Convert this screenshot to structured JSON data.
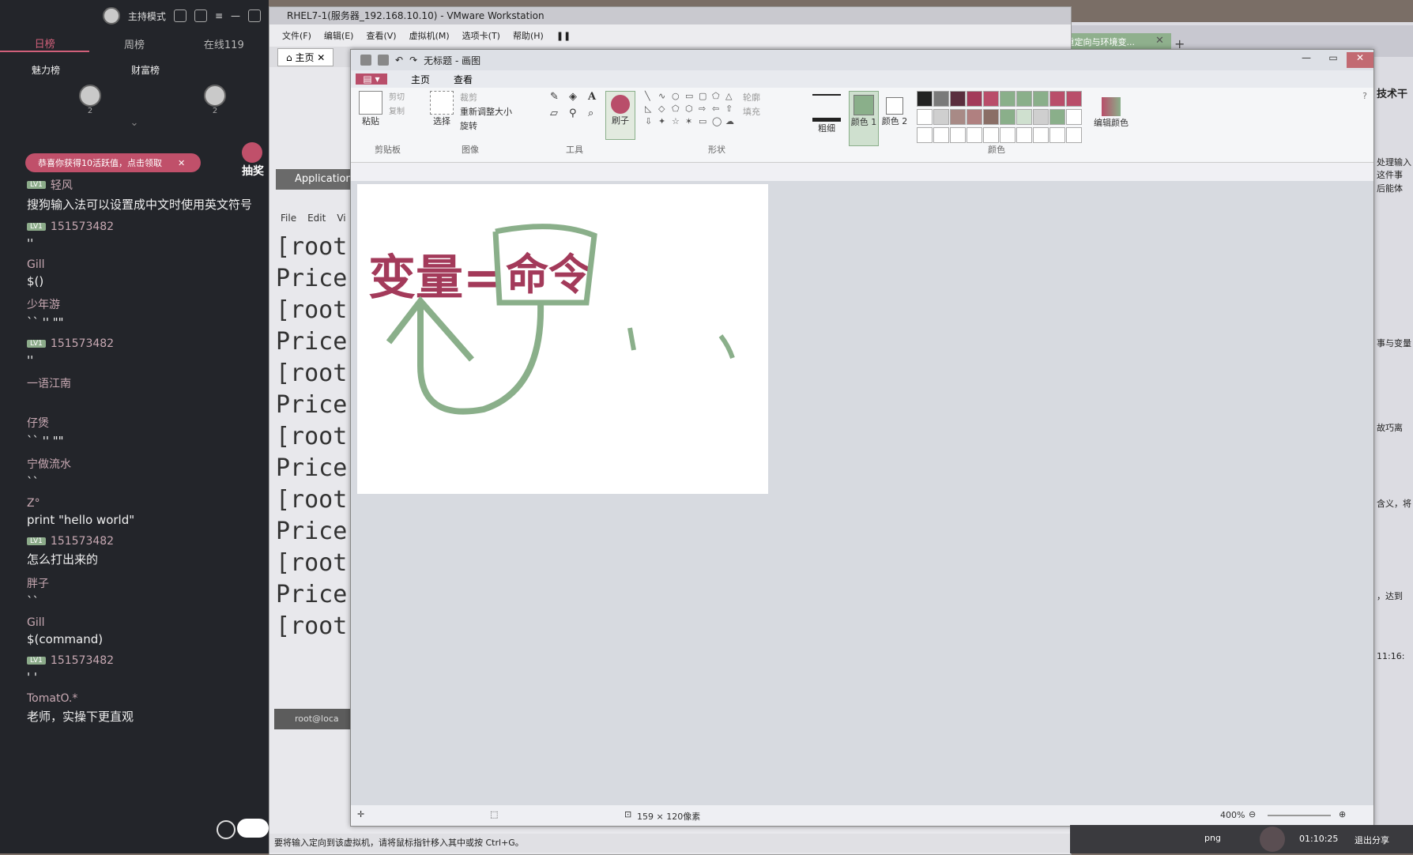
{
  "live_panel": {
    "host_mode": "主持模式",
    "tabs": [
      "日榜",
      "周榜",
      "在线119"
    ],
    "ranks": [
      "魅力榜",
      "财富榜"
    ],
    "rank_counts": [
      "2",
      "2"
    ],
    "notice": "恭喜你获得10活跃值，点击领取",
    "lottery": "抽奖",
    "messages": [
      {
        "user": "轻风",
        "lv": "LV1",
        "text": "搜狗输入法可以设置成中文时使用英文符号"
      },
      {
        "user": "151573482",
        "lv": "LV1",
        "text": "''"
      },
      {
        "user": "Gill",
        "lv": "",
        "text": "$()"
      },
      {
        "user": "少年游",
        "lv": "",
        "text": "`` '' \"\""
      },
      {
        "user": "151573482",
        "lv": "LV1",
        "text": "''"
      },
      {
        "user": "一语江南",
        "lv": "",
        "text": ""
      },
      {
        "user": "仔煲",
        "lv": "",
        "text": "`` '' \"\""
      },
      {
        "user": "宁做流水",
        "lv": "",
        "text": "``"
      },
      {
        "user": "Z°",
        "lv": "",
        "text": "print \"hello world\""
      },
      {
        "user": "151573482",
        "lv": "LV1",
        "text": "怎么打出来的"
      },
      {
        "user": "胖子",
        "lv": "",
        "text": "``"
      },
      {
        "user": "Gill",
        "lv": "",
        "text": "$(command)"
      },
      {
        "user": "151573482",
        "lv": "LV1",
        "text": "'  '"
      },
      {
        "user": "TomatO.*",
        "lv": "",
        "text": "老师，实操下更直观"
      }
    ]
  },
  "vmware": {
    "title": "RHEL7-1(服务器_192.168.10.10) - VMware Workstation",
    "menu": [
      "文件(F)",
      "编辑(E)",
      "查看(V)",
      "虚拟机(M)",
      "选项卡(T)",
      "帮助(H)"
    ],
    "tab": "主页",
    "app_label": "Application",
    "file_menu": [
      "File",
      "Edit",
      "Vi"
    ],
    "terminal_lines": [
      "[root",
      "Price",
      "[root",
      "Price",
      "[root",
      "Price",
      "[root",
      "Price",
      "[root",
      "Price",
      "[root",
      "Price",
      "[root"
    ],
    "task_label": "root@loca",
    "status": "要将输入定向到该虚拟机，请将鼠标指针移入其中或按 Ctrl+G。"
  },
  "right_app": {
    "tab_title": "第3章 管道符、重定向与环境变...",
    "side_texts": [
      "技术干",
      "处理输入",
      "这件事",
      "后能体",
      "事与变量",
      "故巧离",
      "含义，将",
      "，达到",
      "11:16:"
    ]
  },
  "paint": {
    "title": "无标题 - 画图",
    "ribbon_tabs": [
      "主页",
      "查看"
    ],
    "clipboard": {
      "paste": "粘贴",
      "cut": "剪切",
      "copy": "复制",
      "label": "剪贴板"
    },
    "image": {
      "select": "选择",
      "crop": "裁剪",
      "resize": "重新调整大小",
      "rotate": "旋转",
      "label": "图像"
    },
    "tools_label": "工具",
    "brush": "刷子",
    "shapes": {
      "outline": "轮廓",
      "fill": "填充",
      "label": "形状"
    },
    "size": "粗细",
    "color1": "颜色 1",
    "color2": "颜色 2",
    "edit_colors": "编辑颜色",
    "colors_label": "颜色",
    "canvas_text": "变量=",
    "canvas_text2": "命令",
    "dimensions": "159 × 120像素",
    "zoom": "400%",
    "palette": [
      "#222222",
      "#7a7a7a",
      "#5a2e3e",
      "#a33a5a",
      "#b94e6a",
      "#8aaf8a",
      "#8aaf8a",
      "#8aaf8a",
      "#b94e6a",
      "#b94e6a",
      "#ffffff",
      "#cfcfcf",
      "#a88a86",
      "#b08080",
      "#8a6e66",
      "#8aaf8a",
      "#cfe0cf",
      "#cfcfcf",
      "#8aaf8a",
      "#ffffff",
      "#ffffff",
      "#ffffff",
      "#ffffff",
      "#ffffff",
      "#ffffff",
      "#ffffff",
      "#ffffff",
      "#ffffff",
      "#ffffff",
      "#ffffff"
    ]
  },
  "taskbar": {
    "file_type": "png",
    "time": "01:10:25",
    "exit_share": "退出分享"
  }
}
